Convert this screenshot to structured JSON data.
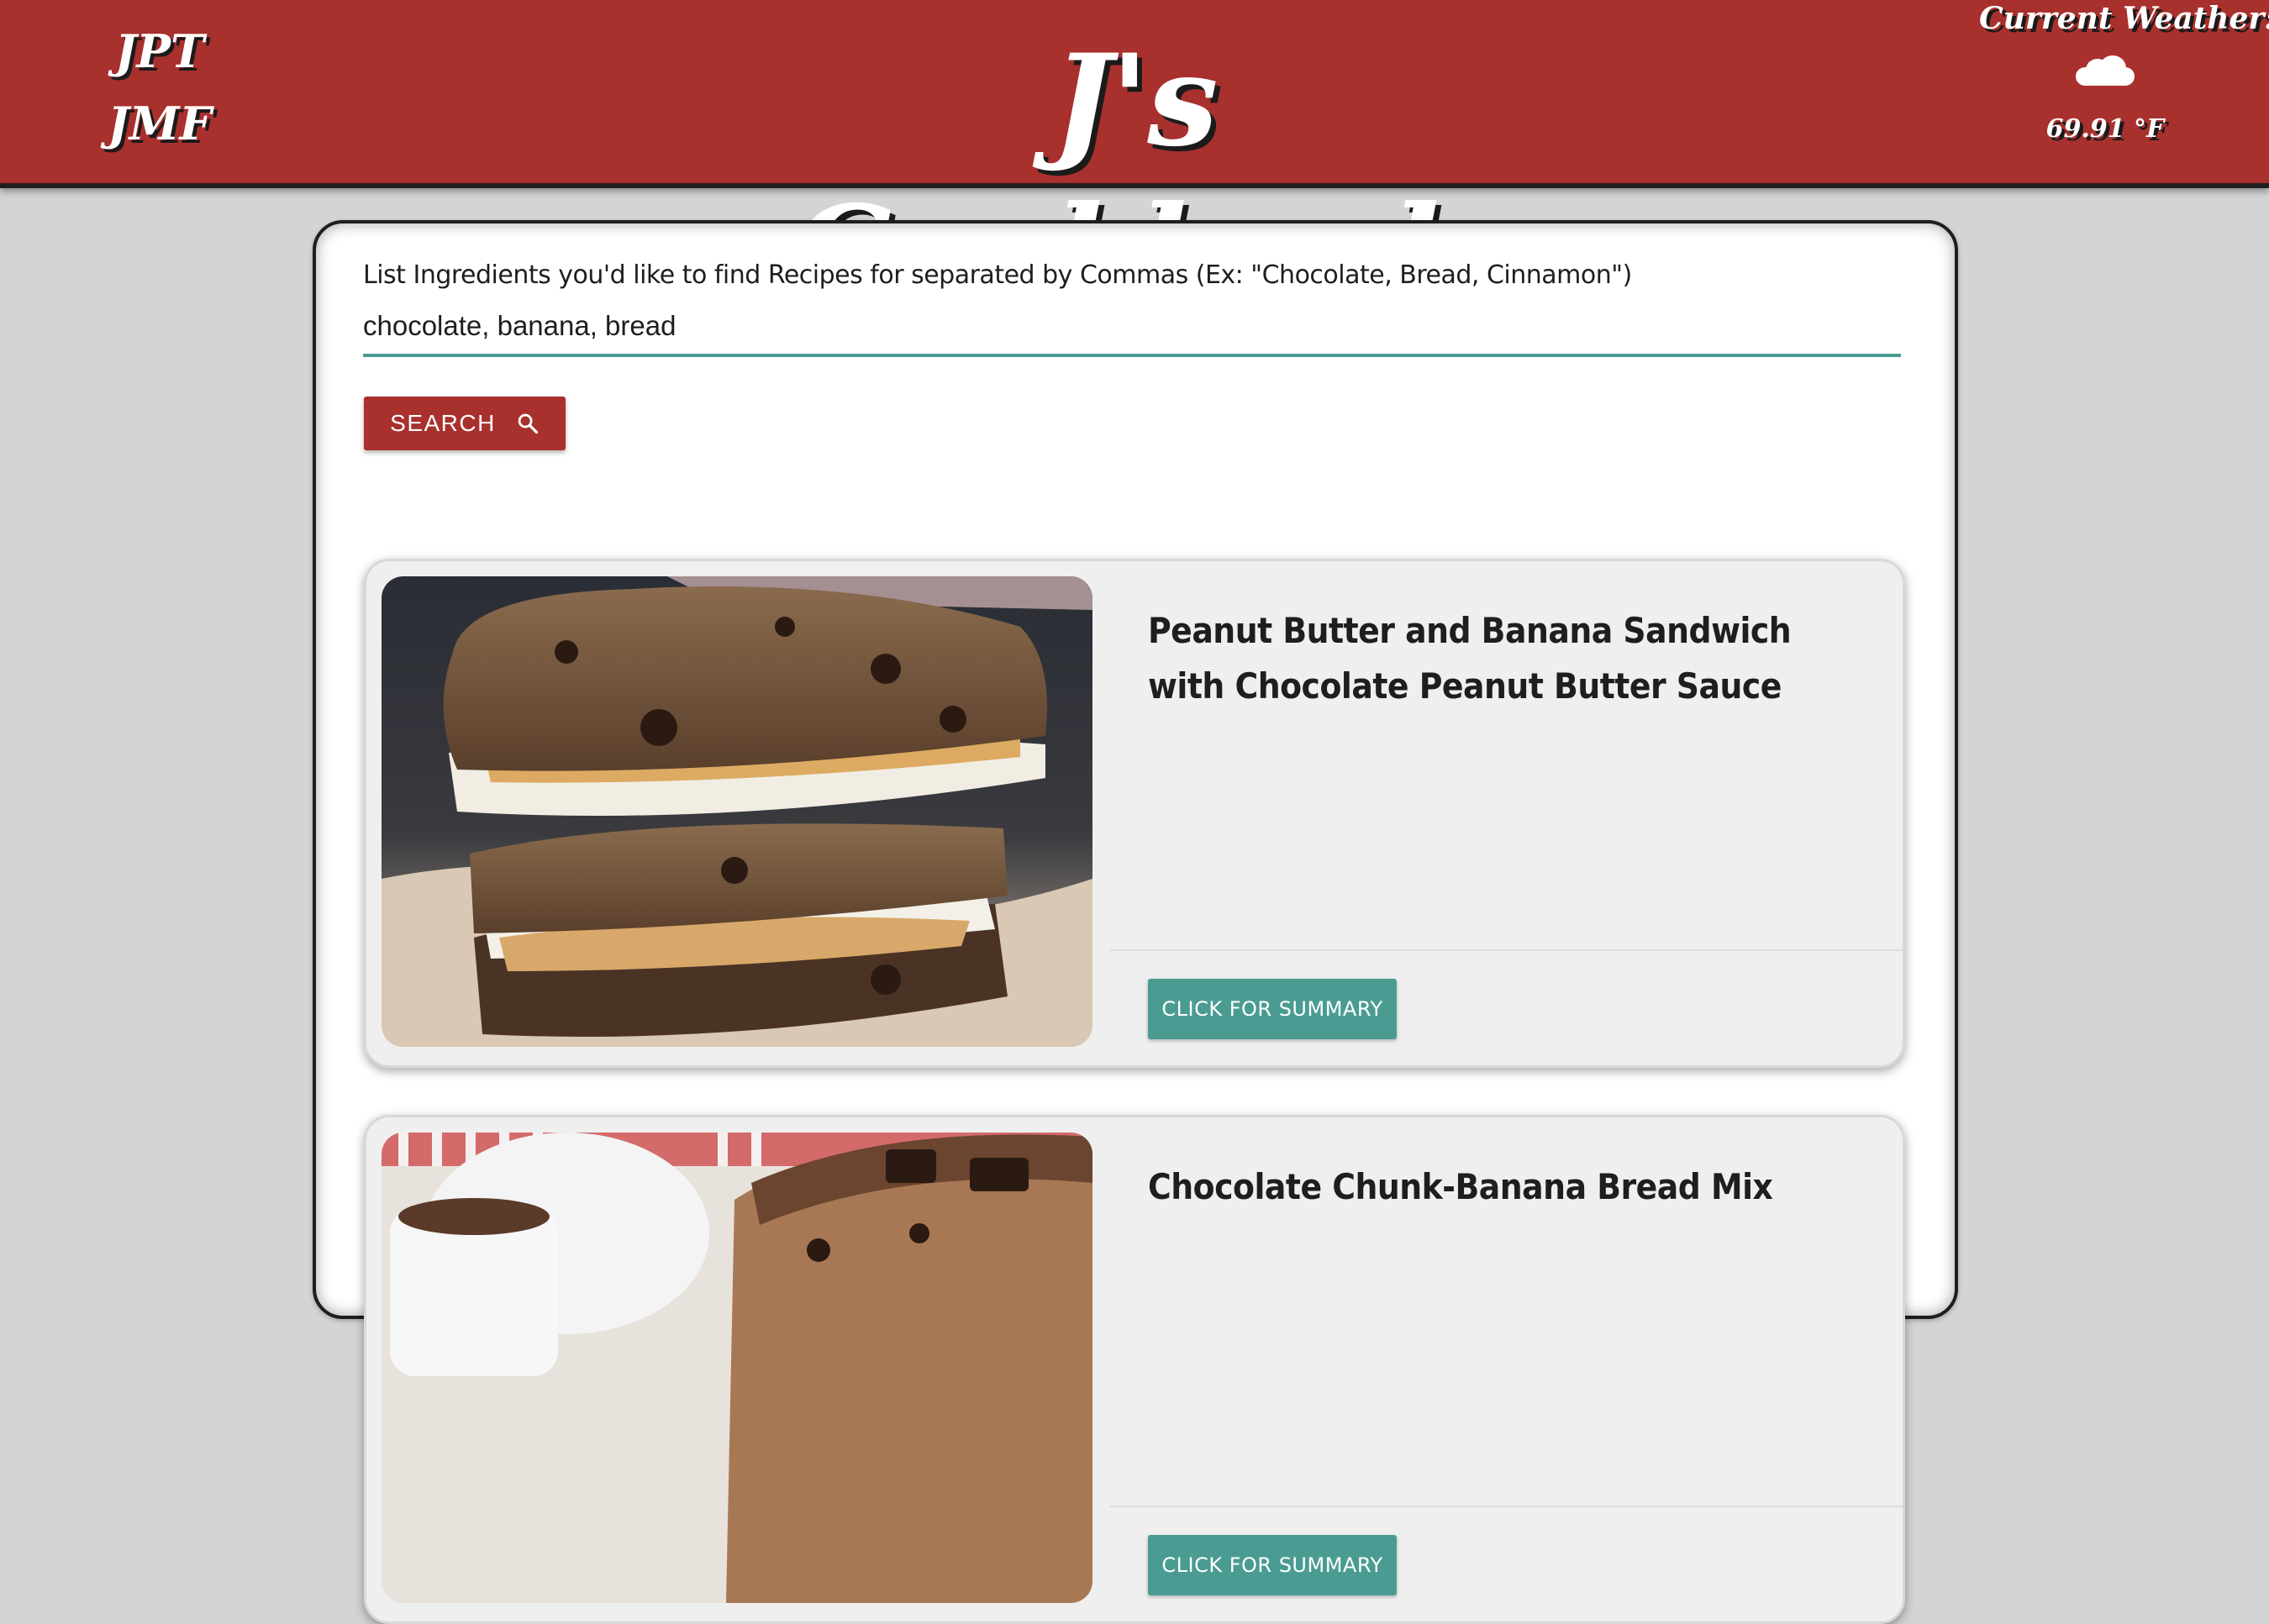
{
  "header": {
    "initials": [
      "JPT",
      "JMF"
    ],
    "title": "J's Cookbook",
    "weather": {
      "label": "Current Weather:",
      "icon": "cloud-icon",
      "temperature": "69.91 °F"
    }
  },
  "search": {
    "label": "List Ingredients you'd like to find Recipes for separated by Commas (Ex: \"Chocolate, Bread, Cinnamon\")",
    "value": "chocolate, banana, bread",
    "button_label": "SEARCH",
    "button_icon": "search-icon"
  },
  "recipes": [
    {
      "title": "Peanut Butter and Banana Sandwich with Chocolate Peanut Butter Sauce",
      "button_label": "CLICK FOR SUMMARY"
    },
    {
      "title": "Chocolate Chunk-Banana Bread Mix",
      "button_label": "CLICK FOR SUMMARY"
    }
  ],
  "colors": {
    "header_red": "#a8302d",
    "accent_teal": "#4a9c92",
    "page_background": "#d4d4d4"
  }
}
